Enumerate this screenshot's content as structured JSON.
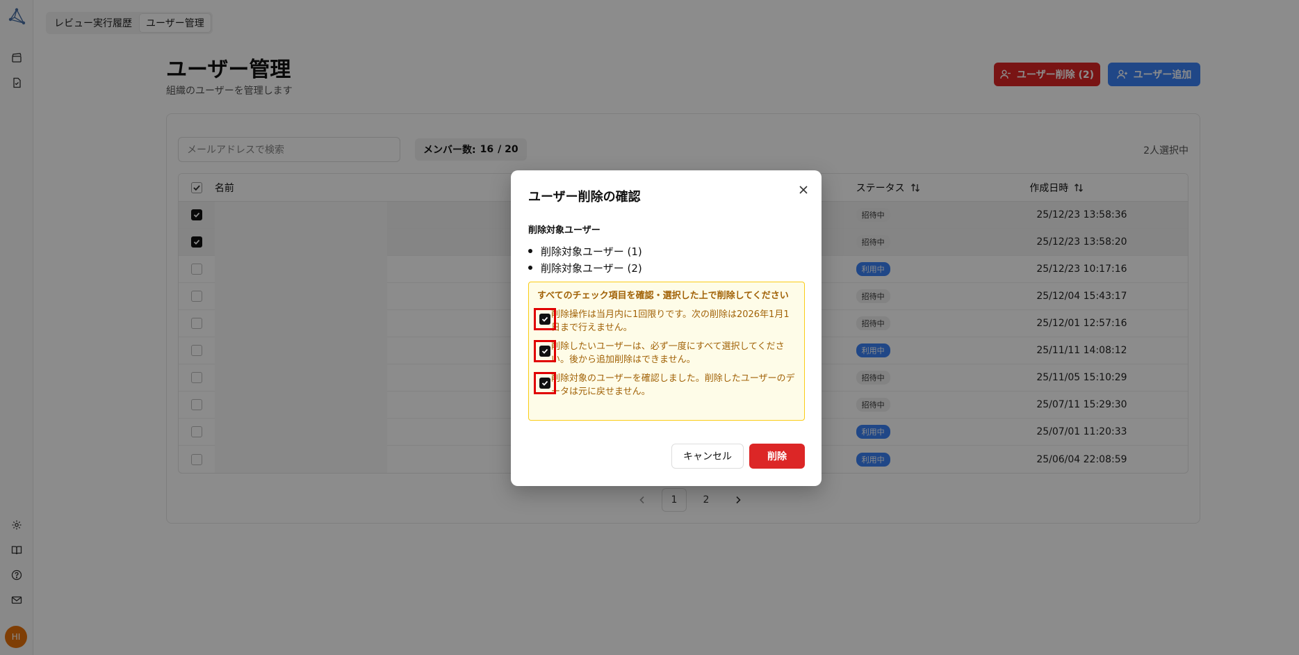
{
  "topnav": {
    "tabs": [
      {
        "label": "レビュー実行履歴"
      },
      {
        "label": "ユーザー管理"
      }
    ]
  },
  "page": {
    "title": "ユーザー管理",
    "subtitle": "組織のユーザーを管理します"
  },
  "actions": {
    "delete_label": "ユーザー削除 (2)",
    "add_label": "ユーザー追加"
  },
  "filters": {
    "search_placeholder": "メールアドレスで検索",
    "members_label": "メンバー数:",
    "members_value": "16",
    "members_total": "/ 20",
    "selected_count": "2人選択中"
  },
  "table": {
    "headers": {
      "name": "名前",
      "status": "ステータス",
      "created": "作成日時"
    },
    "rows": [
      {
        "selected": true,
        "status": "招待中",
        "status_kind": "invite",
        "created": "25/12/23 13:58:36"
      },
      {
        "selected": true,
        "status": "招待中",
        "status_kind": "invite",
        "created": "25/12/23 13:58:20"
      },
      {
        "selected": false,
        "status": "利用中",
        "status_kind": "active",
        "created": "25/12/23 10:17:16"
      },
      {
        "selected": false,
        "status": "招待中",
        "status_kind": "invite",
        "created": "25/12/04 15:43:17"
      },
      {
        "selected": false,
        "status": "招待中",
        "status_kind": "invite",
        "created": "25/12/01 12:57:16"
      },
      {
        "selected": false,
        "status": "利用中",
        "status_kind": "active",
        "created": "25/11/11 14:08:12"
      },
      {
        "selected": false,
        "status": "招待中",
        "status_kind": "invite",
        "created": "25/11/05 15:10:29"
      },
      {
        "selected": false,
        "status": "招待中",
        "status_kind": "invite",
        "created": "25/07/11 15:29:30"
      },
      {
        "selected": false,
        "status": "利用中",
        "status_kind": "active",
        "created": "25/07/01 11:20:33"
      },
      {
        "selected": false,
        "status": "利用中",
        "status_kind": "active",
        "created": "25/06/04 22:08:59"
      }
    ]
  },
  "pager": {
    "pages": [
      "1",
      "2"
    ],
    "current": "1"
  },
  "sidebar": {
    "avatar": "HI"
  },
  "modal": {
    "title": "ユーザー削除の確認",
    "targets_label": "削除対象ユーザー",
    "targets": [
      "削除対象ユーザー (1)",
      "削除対象ユーザー (2)"
    ],
    "warning_head": "すべてのチェック項目を確認・選択した上で削除してください",
    "checks": [
      "削除操作は当月内に1回限りです。次の削除は2026年1月1日まで行えません。",
      "削除したいユーザーは、必ず一度にすべて選択してください。後から追加削除はできません。",
      "削除対象のユーザーを確認しました。削除したユーザーのデータは元に戻せません。"
    ],
    "cancel_label": "キャンセル",
    "delete_label": "削除"
  },
  "colors": {
    "danger": "#dc2626",
    "primary": "#3b82f6",
    "warning_bg": "#fefce8",
    "warning_border": "#facc15",
    "warning_text": "#a16207"
  }
}
